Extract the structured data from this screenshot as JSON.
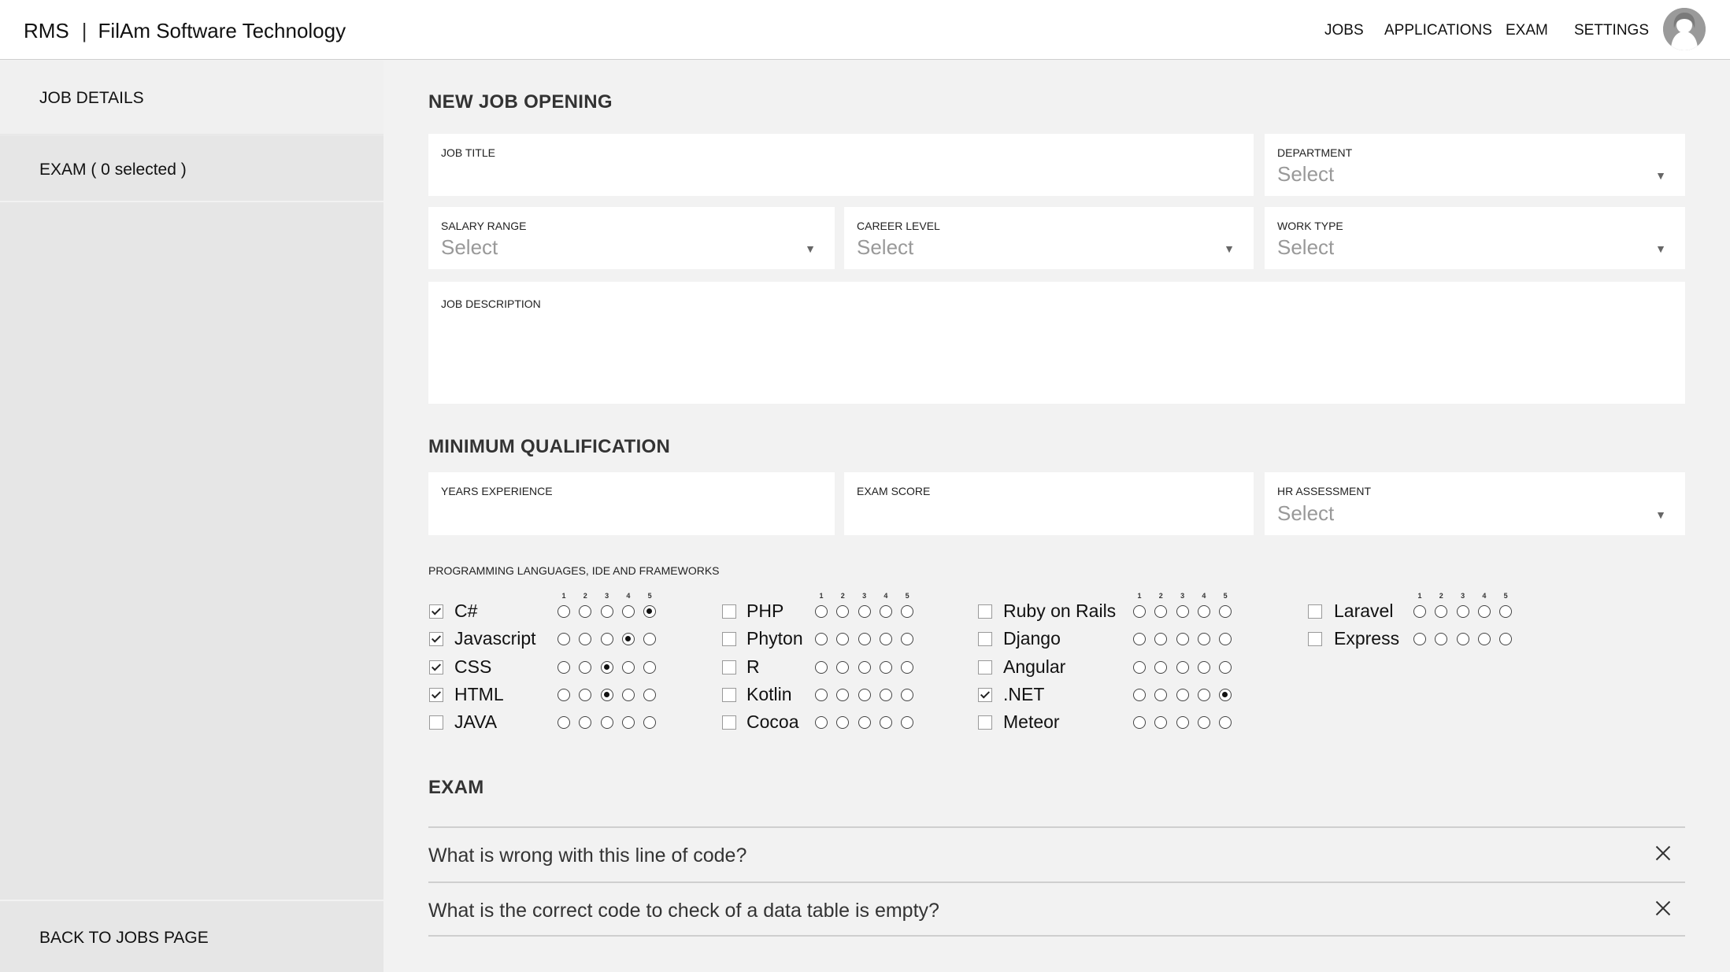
{
  "header": {
    "app": "RMS",
    "separator": "|",
    "company": "FilAm Software Technology",
    "nav": [
      "JOBS",
      "APPLICATIONS",
      "EXAM",
      "SETTINGS"
    ]
  },
  "sidebar": {
    "items": [
      "JOB DETAILS",
      "EXAM ( 0 selected )"
    ],
    "back": "BACK TO JOBS PAGE"
  },
  "job": {
    "title": "NEW JOB OPENING",
    "fields": {
      "job_title": {
        "label": "JOB TITLE",
        "value": ""
      },
      "department": {
        "label": "DEPARTMENT",
        "value": "Select"
      },
      "salary_range": {
        "label": "SALARY RANGE",
        "value": "Select"
      },
      "career_level": {
        "label": "CAREER LEVEL",
        "value": "Select"
      },
      "work_type": {
        "label": "WORK TYPE",
        "value": "Select"
      },
      "job_description": {
        "label": "JOB DESCRIPTION",
        "value": ""
      }
    }
  },
  "qualification": {
    "title": "MINIMUM QUALIFICATION",
    "fields": {
      "years_experience": {
        "label": "YEARS EXPERIENCE",
        "value": ""
      },
      "exam_score": {
        "label": "EXAM SCORE",
        "value": ""
      },
      "hr_assessment": {
        "label": "HR ASSESSMENT",
        "value": "Select"
      }
    },
    "languages_label": "PROGRAMMING LANGUAGES, IDE AND FRAMEWORKS",
    "scale": [
      "1",
      "2",
      "3",
      "4",
      "5"
    ],
    "columns": [
      [
        {
          "name": "C#",
          "checked": true,
          "rating": 5
        },
        {
          "name": "Javascript",
          "checked": true,
          "rating": 4
        },
        {
          "name": "CSS",
          "checked": true,
          "rating": 3
        },
        {
          "name": "HTML",
          "checked": true,
          "rating": 3
        },
        {
          "name": "JAVA",
          "checked": false,
          "rating": 0
        }
      ],
      [
        {
          "name": "PHP",
          "checked": false,
          "rating": 0
        },
        {
          "name": "Phyton",
          "checked": false,
          "rating": 0
        },
        {
          "name": "R",
          "checked": false,
          "rating": 0
        },
        {
          "name": "Kotlin",
          "checked": false,
          "rating": 0
        },
        {
          "name": "Cocoa",
          "checked": false,
          "rating": 0
        }
      ],
      [
        {
          "name": "Ruby on Rails",
          "checked": false,
          "rating": 0
        },
        {
          "name": "Django",
          "checked": false,
          "rating": 0
        },
        {
          "name": "Angular",
          "checked": false,
          "rating": 0
        },
        {
          "name": ".NET",
          "checked": true,
          "rating": 5
        },
        {
          "name": "Meteor",
          "checked": false,
          "rating": 0
        }
      ],
      [
        {
          "name": "Laravel",
          "checked": false,
          "rating": 0
        },
        {
          "name": "Express",
          "checked": false,
          "rating": 0
        }
      ]
    ]
  },
  "exam": {
    "title": "EXAM",
    "questions": [
      "What is wrong with this line of code?",
      "What is the correct code to check of a data table is empty?"
    ]
  }
}
